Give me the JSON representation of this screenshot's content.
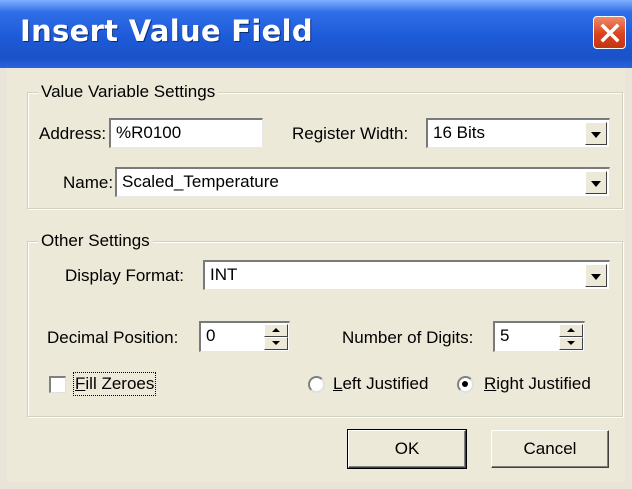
{
  "window": {
    "title": "Insert Value Field"
  },
  "value_variable_settings": {
    "group_title": "Value Variable Settings",
    "address_label": "Address:",
    "address_value": "%R0100",
    "register_width_label": "Register Width:",
    "register_width_value": "16 Bits",
    "name_label": "Name:",
    "name_value": "Scaled_Temperature"
  },
  "other_settings": {
    "group_title": "Other Settings",
    "display_format_label": "Display Format:",
    "display_format_value": "INT",
    "decimal_position_label": "Decimal Position:",
    "decimal_position_value": "0",
    "number_of_digits_label": "Number of Digits:",
    "number_of_digits_value": "5",
    "fill_zeroes_label": "Fill Zeroes",
    "fill_zeroes_checked": false,
    "left_justified_label": "Left Justified",
    "right_justified_label": "Right Justified",
    "justification_selected": "Right Justified"
  },
  "buttons": {
    "ok_label": "OK",
    "cancel_label": "Cancel"
  },
  "colors": {
    "titlebar": "#1d5ad8",
    "close": "#d9441c",
    "dialog_bg": "#ece9d8"
  }
}
